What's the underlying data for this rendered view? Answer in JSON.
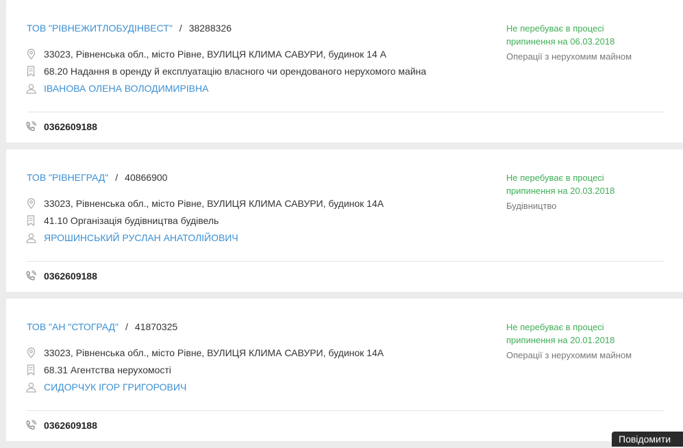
{
  "companies": [
    {
      "name": "ТОВ \"РІВНЕЖИТЛОБУДІНВЕСТ\"",
      "separator": "/",
      "code": "38288326",
      "address": "33023, Рівненська обл., місто Рівне, ВУЛИЦЯ КЛИМА САВУРИ, будинок 14 А",
      "kved": "68.20 Надання в оренду й експлуатацію власного чи орендованого нерухомого майна",
      "person": "ІВАНОВА ОЛЕНА ВОЛОДИМИРІВНА",
      "phone": "0362609188",
      "status": "Не перебуває в процесі припинення на 06.03.2018",
      "activity": "Операції з нерухомим майном"
    },
    {
      "name": "ТОВ \"РІВНЕГРАД\"",
      "separator": "/",
      "code": "40866900",
      "address": "33023, Рівненська обл., місто Рівне, ВУЛИЦЯ КЛИМА САВУРИ, будинок 14А",
      "kved": "41.10 Організація будівництва будівель",
      "person": "ЯРОШИНСЬКИЙ РУСЛАН АНАТОЛІЙОВИЧ",
      "phone": "0362609188",
      "status": "Не перебуває в процесі припинення на 20.03.2018",
      "activity": "Будівництво"
    },
    {
      "name": "ТОВ \"АН \"СТОГРАД\"",
      "separator": "/",
      "code": "41870325",
      "address": "33023, Рівненська обл., місто Рівне, ВУЛИЦЯ КЛИМА САВУРИ, будинок 14А",
      "kved": "68.31 Агентства нерухомості",
      "person": "СИДОРЧУК ІГОР ГРИГОРОВИЧ",
      "phone": "0362609188",
      "status": "Не перебуває в процесі припинення на 20.01.2018",
      "activity": "Операції з нерухомим майном"
    }
  ],
  "report_button": "Повідомити",
  "colors": {
    "link": "#3b8fd2",
    "status_active": "#3fae55",
    "muted": "#777777",
    "icon": "#b5b5b5"
  }
}
